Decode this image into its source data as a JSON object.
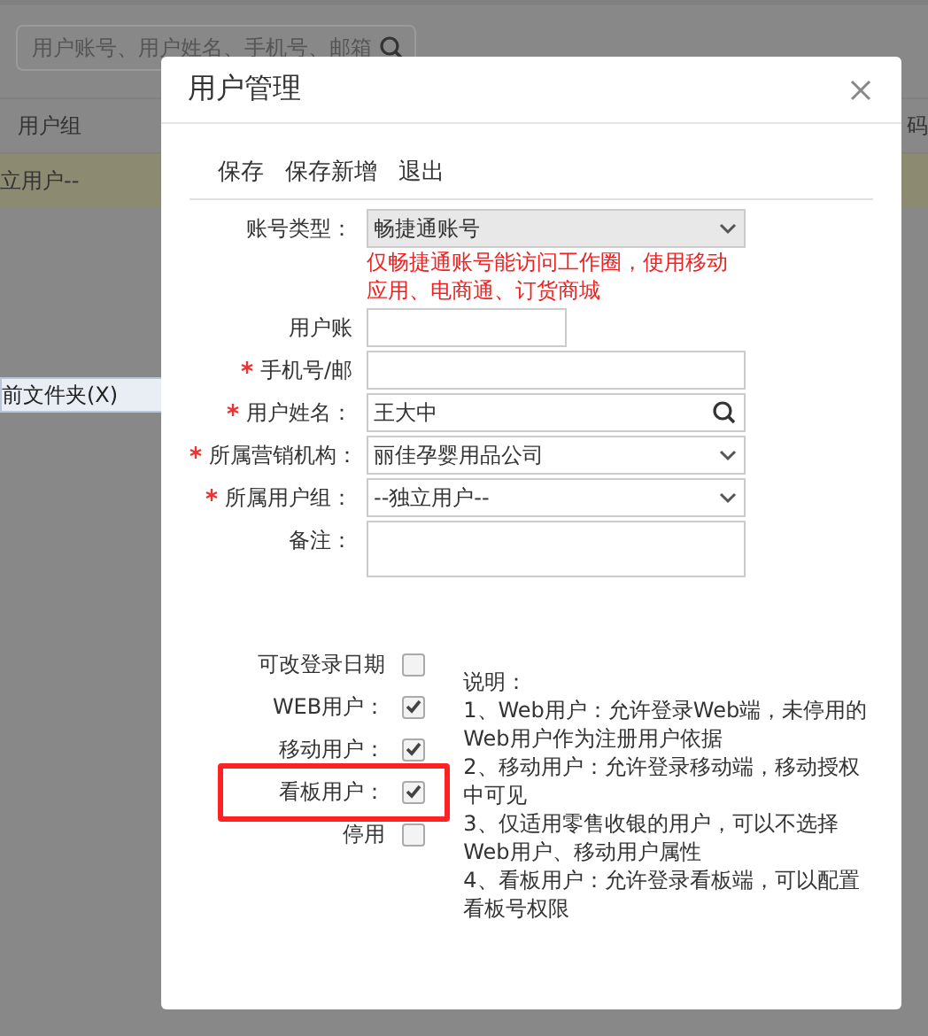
{
  "background": {
    "search": {
      "placeholder": "用户账号、用户姓名、手机号、邮箱"
    },
    "table": {
      "columns": [
        "用户组",
        "码"
      ],
      "rows": [
        {
          "cells": [
            "立用户--"
          ],
          "selected": true
        }
      ]
    }
  },
  "context_menu": {
    "items": [
      "前文件夹(X)"
    ]
  },
  "dialog": {
    "title": "用户管理",
    "toolbar": [
      "保存",
      "保存新增",
      "退出"
    ],
    "fields": [
      {
        "kind": "select",
        "label": "账号类型：",
        "required": false,
        "disabled": true,
        "value": "畅捷通账号",
        "note": "仅畅捷通账号能访问工作圈，使用移动应用、电商通、订货商城"
      },
      {
        "kind": "short",
        "label": "用户账",
        "required": false
      },
      {
        "kind": "text",
        "label": "手机号/邮",
        "required": true
      },
      {
        "kind": "lookup",
        "label": "用户姓名：",
        "required": true,
        "value": "王大中"
      },
      {
        "kind": "select",
        "label": "所属营销机构：",
        "required": true,
        "disabled": false,
        "value": "丽佳孕婴用品公司"
      },
      {
        "kind": "select",
        "label": "所属用户组：",
        "required": true,
        "disabled": false,
        "value": "--独立用户--"
      },
      {
        "kind": "textarea",
        "label": "备注：",
        "required": false
      }
    ],
    "options": [
      {
        "label": "可改登录日期",
        "checked": false,
        "highlighted": false
      },
      {
        "label": "WEB用户：",
        "checked": true,
        "highlighted": false
      },
      {
        "label": "移动用户：",
        "checked": true,
        "highlighted": false
      },
      {
        "label": "看板用户：",
        "checked": true,
        "highlighted": true
      },
      {
        "label": "停用",
        "checked": false,
        "highlighted": false
      }
    ],
    "notes": [
      "说明：",
      "1、Web用户：允许登录Web端，未停用的Web用户作为注册用户依据",
      "2、移动用户：允许登录移动端，移动授权中可见",
      "3、仅适用零售收银的用户，可以不选择Web用户、移动用户属性",
      "4、看板用户：允许登录看板端，可以配置看板号权限"
    ]
  }
}
